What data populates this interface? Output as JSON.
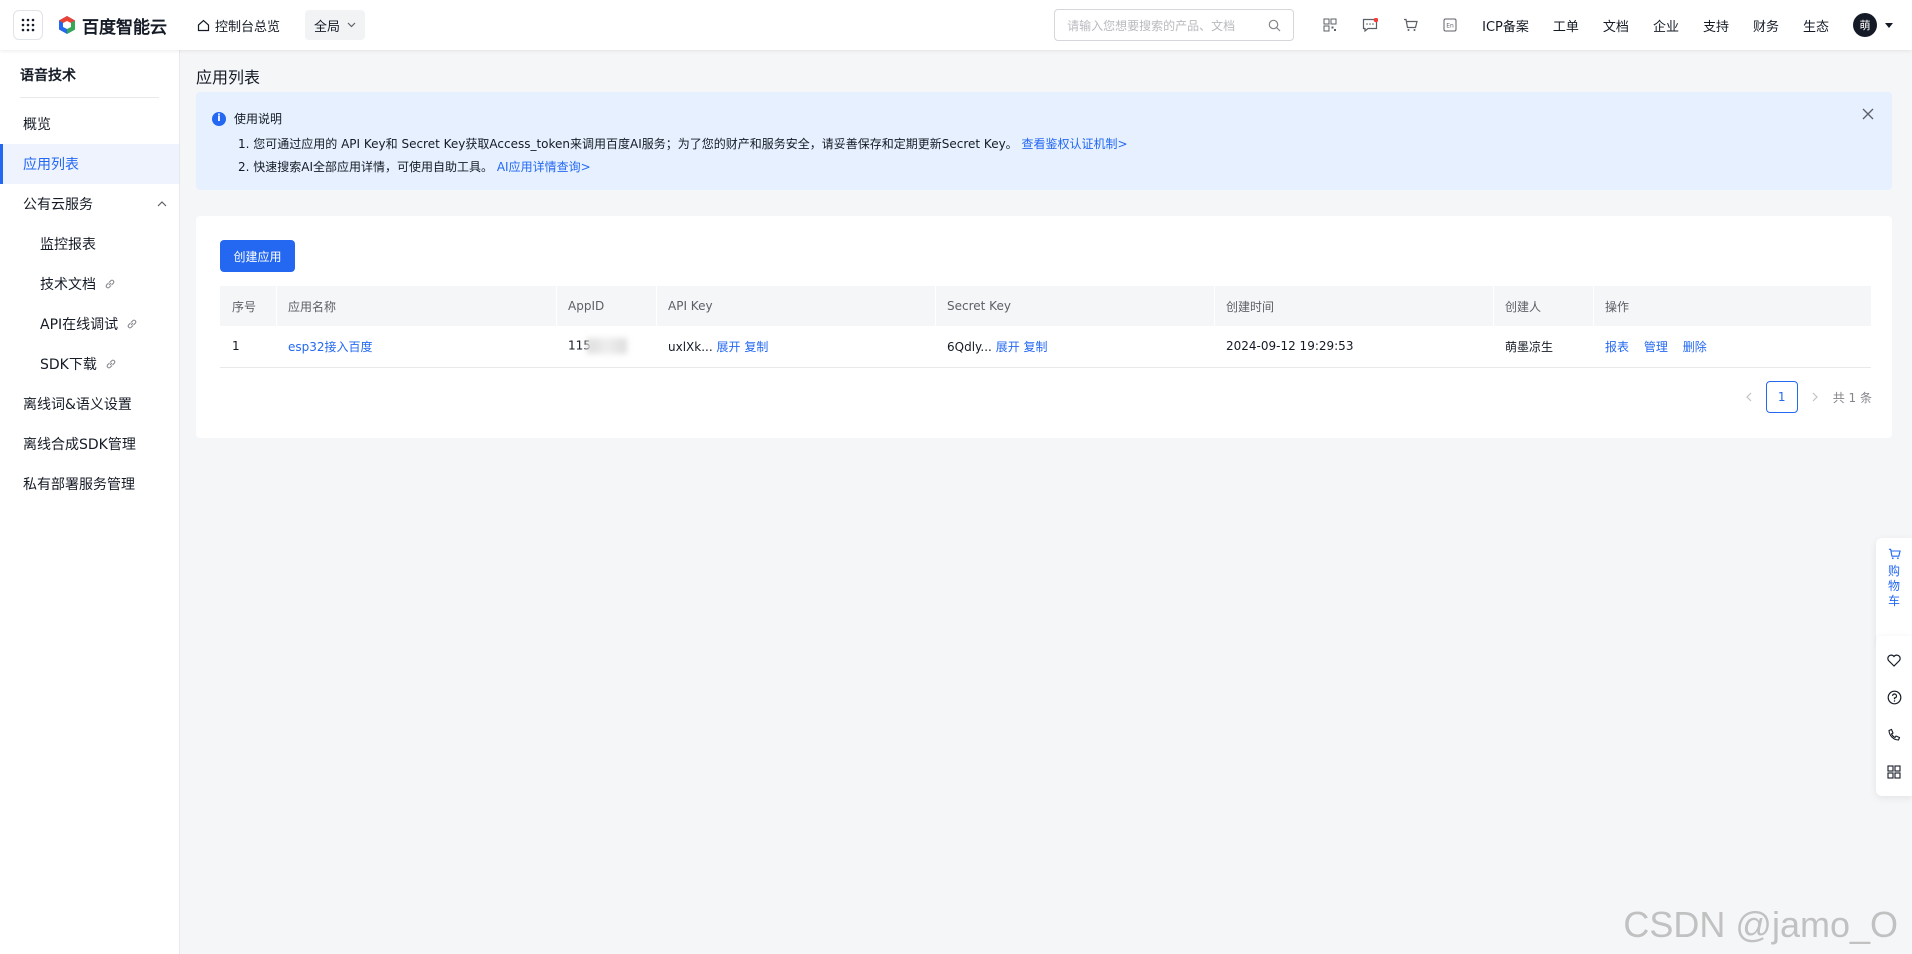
{
  "topbar": {
    "brand": "百度智能云",
    "home_label": "控制台总览",
    "scope_label": "全局",
    "search_placeholder": "请输入您想要搜索的产品、文档",
    "nav_links": [
      "ICP备案",
      "工单",
      "文档",
      "企业",
      "支持",
      "财务",
      "生态"
    ],
    "avatar_text": "萌"
  },
  "sidebar": {
    "title": "语音技术",
    "items": [
      {
        "label": "概览"
      },
      {
        "label": "应用列表",
        "active": true
      },
      {
        "label": "公有云服务"
      },
      {
        "label": "监控报表"
      },
      {
        "label": "技术文档"
      },
      {
        "label": "API在线调试"
      },
      {
        "label": "SDK下载"
      },
      {
        "label": "离线词&语义设置"
      },
      {
        "label": "离线合成SDK管理"
      },
      {
        "label": "私有部署服务管理"
      }
    ]
  },
  "main": {
    "page_title": "应用列表",
    "notice": {
      "title": "使用说明",
      "line1": "1. 您可通过应用的 API Key和 Secret Key获取Access_token来调用百度AI服务；为了您的财产和服务安全，请妥善保存和定期更新Secret Key。",
      "line1_link": "查看鉴权认证机制>",
      "line2": "2. 快速搜索AI全部应用详情，可使用自助工具。",
      "line2_link": "AI应用详情查询>"
    },
    "create_button": "创建应用",
    "table": {
      "headers": [
        "序号",
        "应用名称",
        "AppID",
        "API Key",
        "Secret Key",
        "创建时间",
        "创建人",
        "操作"
      ],
      "rows": [
        {
          "index": "1",
          "name": "esp32接入百度",
          "app_id": "115",
          "api_key": "uxlXk...",
          "secret_key": "6Qdly...",
          "expand": "展开",
          "copy": "复制",
          "created": "2024-09-12 19:29:53",
          "creator": "萌墨凉生",
          "ops": [
            "报表",
            "管理",
            "删除"
          ]
        }
      ]
    },
    "pagination": {
      "current": "1",
      "total": "共 1 条"
    }
  },
  "float": {
    "cart_label": [
      "购",
      "物",
      "车"
    ]
  },
  "watermark": "CSDN @jamo_O",
  "colors": {
    "accent": "#2468f2",
    "notice_bg": "#e6f0ff"
  }
}
